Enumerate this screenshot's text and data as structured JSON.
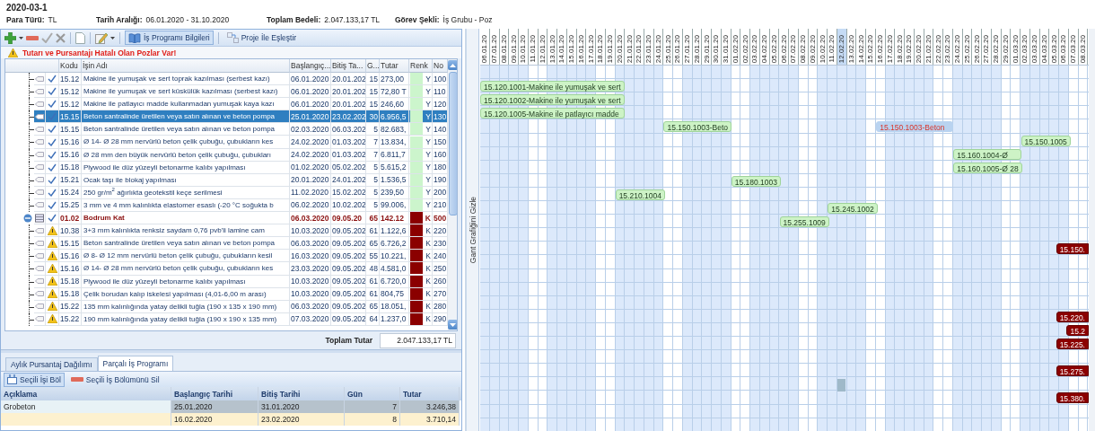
{
  "title": "2020-03-1",
  "info": [
    {
      "label": "Para Türü:",
      "value": "TL"
    },
    {
      "label": "Tarih Aralığı:",
      "value": "06.01.2020 - 31.10.2020"
    },
    {
      "label": "Toplam Bedeli:",
      "value": "2.047.133,17 TL"
    },
    {
      "label": "Görev Şekli:",
      "value": "İş Grubu - Poz"
    }
  ],
  "toolbar": {
    "info_button": {
      "label": "İş Programı Bilgileri",
      "selected": true
    },
    "match_button": {
      "label": "Proje İle Eşleştir"
    }
  },
  "warning": "Tutarı ve Pursantajı Hatalı Olan Pozlar Var!",
  "table": {
    "columns": [
      "Kodu",
      "İşin Adı",
      "Başlangıç...",
      "Bitiş Ta...",
      "G...",
      "Tutar",
      "Renk",
      "No"
    ],
    "rows": [
      {
        "kind": "task",
        "has_error": false,
        "selected": false,
        "code": "15.12",
        "name": "Makine ile yumuşak ve sert toprak kazılması (serbest kazı)",
        "start": "06.01.2020",
        "end": "20.01.202",
        "days": "15",
        "amount": "273,00",
        "color": "#ccf5cc",
        "color_code": "Y",
        "no": "100"
      },
      {
        "kind": "task",
        "has_error": false,
        "selected": false,
        "code": "15.12",
        "name": "Makine ile yumuşak ve sert küskülük kazılması (serbest kazı)",
        "start": "06.01.2020",
        "end": "20.01.202",
        "days": "15",
        "amount": "72,80 T",
        "color": "#ccf5cc",
        "color_code": "Y",
        "no": "110"
      },
      {
        "kind": "task",
        "has_error": false,
        "selected": false,
        "code": "15.12",
        "name": "Makine ile patlayıcı madde kullanmadan yumuşak kaya kazı",
        "start": "06.01.2020",
        "end": "20.01.202",
        "days": "15",
        "amount": "246,60",
        "color": "#ccf5cc",
        "color_code": "Y",
        "no": "120"
      },
      {
        "kind": "task",
        "has_error": false,
        "selected": true,
        "code": "15.15",
        "name": "Beton santralinde üretilen veya satın alınan ve beton pompa",
        "start": "25.01.2020",
        "end": "23.02.202",
        "days": "30",
        "amount": "6.956,5",
        "color": "#ccf5cc",
        "color_code": "Y",
        "no": "130"
      },
      {
        "kind": "task",
        "has_error": false,
        "selected": false,
        "code": "15.15",
        "name": "Beton santralinde üretilen veya satın alınan ve beton pompa",
        "start": "02.03.2020",
        "end": "06.03.202",
        "days": "5",
        "amount": "82.683,",
        "color": "#ccf5cc",
        "color_code": "Y",
        "no": "140"
      },
      {
        "kind": "task",
        "has_error": false,
        "selected": false,
        "code": "15.16",
        "name": "Ø 14- Ø 28 mm nervürlü beton çelik çubuğu, çubukların kes",
        "start": "24.02.2020",
        "end": "01.03.202",
        "days": "7",
        "amount": "13.834,",
        "color": "#ccf5cc",
        "color_code": "Y",
        "no": "150"
      },
      {
        "kind": "task",
        "has_error": false,
        "selected": false,
        "code": "15.16",
        "name": "Ø 28 mm den büyük nervürlü beton çelik çubuğu, çubukları",
        "start": "24.02.2020",
        "end": "01.03.202",
        "days": "7",
        "amount": "6.811,7",
        "color": "#ccf5cc",
        "color_code": "Y",
        "no": "160"
      },
      {
        "kind": "task",
        "has_error": false,
        "selected": false,
        "code": "15.18",
        "name": "Plywood ile düz yüzeyli betonarme kalıbı yapılması",
        "start": "01.02.2020",
        "end": "05.02.202",
        "days": "5",
        "amount": "5.615,2",
        "color": "#ccf5cc",
        "color_code": "Y",
        "no": "180"
      },
      {
        "kind": "task",
        "has_error": false,
        "selected": false,
        "code": "15.21",
        "name": "Ocak taşı ile blokaj yapılması",
        "start": "20.01.2020",
        "end": "24.01.202",
        "days": "5",
        "amount": "1.536,5",
        "color": "#ccf5cc",
        "color_code": "Y",
        "no": "190"
      },
      {
        "kind": "task",
        "has_error": false,
        "selected": false,
        "code": "15.24",
        "name": "250 gr/m$^{2}$ ağırlıkta geotekstil keçe serilmesi",
        "start": "11.02.2020",
        "end": "15.02.202",
        "days": "5",
        "amount": "239,50",
        "color": "#ccf5cc",
        "color_code": "Y",
        "no": "200"
      },
      {
        "kind": "task",
        "has_error": false,
        "selected": false,
        "code": "15.25",
        "name": "3 mm ve 4 mm kalınlıkta elastomer esaslı (-20 °C soğukta b",
        "start": "06.02.2020",
        "end": "10.02.202",
        "days": "5",
        "amount": "99.006,",
        "color": "#ccf5cc",
        "color_code": "Y",
        "no": "210"
      },
      {
        "kind": "group",
        "has_error": false,
        "selected": false,
        "expanded": true,
        "code": "01.02",
        "name": "Bodrum Kat",
        "start": "06.03.2020",
        "end": "09.05.20",
        "days": "65",
        "amount": "142.12",
        "color": "#8b0000",
        "color_code": "K",
        "no": "500"
      },
      {
        "kind": "task",
        "has_error": true,
        "selected": false,
        "code": "10.38",
        "name": "3+3 mm kalınlıkta renksiz saydam 0,76 pvb'li lamine cam",
        "start": "10.03.2020",
        "end": "09.05.202",
        "days": "61",
        "amount": "1.122,6",
        "color": "#8b0000",
        "color_code": "K",
        "no": "220"
      },
      {
        "kind": "task",
        "has_error": true,
        "selected": false,
        "code": "15.15",
        "name": "Beton santralinde üretilen veya satın alınan ve beton pompa",
        "start": "06.03.2020",
        "end": "09.05.202",
        "days": "65",
        "amount": "6.726,2",
        "color": "#8b0000",
        "color_code": "K",
        "no": "230"
      },
      {
        "kind": "task",
        "has_error": true,
        "selected": false,
        "code": "15.16",
        "name": "Ø 8- Ø 12 mm nervürlü beton çelik çubuğu, çubukların kesil",
        "start": "16.03.2020",
        "end": "09.05.202",
        "days": "55",
        "amount": "10.221,",
        "color": "#8b0000",
        "color_code": "K",
        "no": "240"
      },
      {
        "kind": "task",
        "has_error": true,
        "selected": false,
        "code": "15.16",
        "name": "Ø 14- Ø 28 mm nervürlü beton çelik çubuğu, çubukların kes",
        "start": "23.03.2020",
        "end": "09.05.202",
        "days": "48",
        "amount": "4.581,0",
        "color": "#8b0000",
        "color_code": "K",
        "no": "250"
      },
      {
        "kind": "task",
        "has_error": true,
        "selected": false,
        "code": "15.18",
        "name": "Plywood ile düz yüzeyli betonarme kalıbı yapılması",
        "start": "10.03.2020",
        "end": "09.05.202",
        "days": "61",
        "amount": "6.720,0",
        "color": "#8b0000",
        "color_code": "K",
        "no": "260"
      },
      {
        "kind": "task",
        "has_error": true,
        "selected": false,
        "code": "15.18",
        "name": "Çelik borudan kalıp iskelesi yapılması (4,01-6,00 m arası)",
        "start": "10.03.2020",
        "end": "09.05.202",
        "days": "61",
        "amount": "804,75",
        "color": "#8b0000",
        "color_code": "K",
        "no": "270"
      },
      {
        "kind": "task",
        "has_error": true,
        "selected": false,
        "code": "15.22",
        "name": "135 mm kalınlığında yatay delikli tuğla (190 x 135 x 190 mm)",
        "start": "06.03.2020",
        "end": "09.05.202",
        "days": "65",
        "amount": "18.051,",
        "color": "#8b0000",
        "color_code": "K",
        "no": "280"
      },
      {
        "kind": "task",
        "has_error": true,
        "selected": false,
        "code": "15.22",
        "name": "190 mm kalınlığında yatay delikli tuğla (190 x 190 x 135 mm)",
        "start": "07.03.2020",
        "end": "09.05.202",
        "days": "64",
        "amount": "1.237,0",
        "color": "#8b0000",
        "color_code": "K",
        "no": "290"
      }
    ]
  },
  "total": {
    "label": "Toplam Tutar",
    "value": "2.047.133,17 TL"
  },
  "bottom": {
    "tabs": [
      {
        "label": "Aylık Pursantaj Dağılımı",
        "selected": false
      },
      {
        "label": "Parçalı İş Programı",
        "selected": true
      }
    ],
    "actions": [
      {
        "label": "Seçili İşi Böl",
        "selected": true
      },
      {
        "label": "Seçili İş Bölümünü Sil",
        "selected": false
      }
    ],
    "columns": [
      "Açıklama",
      "Başlangıç Tarihi",
      "Bitiş Tarihi",
      "Gün",
      "Tutar"
    ],
    "rows": [
      {
        "description": "Grobeton",
        "start": "25.01.2020",
        "end": "31.01.2020",
        "days": "7",
        "amount": "3.246,38",
        "selected": true
      },
      {
        "start": "16.02.2020",
        "end": "23.02.2020",
        "days": "8",
        "amount": "3.710,14",
        "selected": false
      }
    ]
  },
  "gantt": {
    "toggle_label": "Gant Grafiğini Gizle",
    "days": [
      {
        "label": "06.01.20",
        "weekend": false,
        "selected": false
      },
      {
        "label": "07.01.20",
        "weekend": false,
        "selected": false
      },
      {
        "label": "08.01.20",
        "weekend": false,
        "selected": false
      },
      {
        "label": "09.01.20",
        "weekend": false,
        "selected": false
      },
      {
        "label": "10.01.20",
        "weekend": false,
        "selected": false
      },
      {
        "label": "11.01.20",
        "weekend": true,
        "selected": false
      },
      {
        "label": "12.01.20",
        "weekend": true,
        "selected": false
      },
      {
        "label": "13.01.20",
        "weekend": false,
        "selected": false
      },
      {
        "label": "14.01.20",
        "weekend": false,
        "selected": false
      },
      {
        "label": "15.01.20",
        "weekend": false,
        "selected": false
      },
      {
        "label": "16.01.20",
        "weekend": false,
        "selected": false
      },
      {
        "label": "17.01.20",
        "weekend": false,
        "selected": false
      },
      {
        "label": "18.01.20",
        "weekend": true,
        "selected": false
      },
      {
        "label": "19.01.20",
        "weekend": true,
        "selected": false
      },
      {
        "label": "20.01.20",
        "weekend": false,
        "selected": false
      },
      {
        "label": "21.01.20",
        "weekend": false,
        "selected": false
      },
      {
        "label": "22.01.20",
        "weekend": false,
        "selected": false
      },
      {
        "label": "23.01.20",
        "weekend": false,
        "selected": false
      },
      {
        "label": "24.01.20",
        "weekend": false,
        "selected": false
      },
      {
        "label": "25.01.20",
        "weekend": true,
        "selected": false
      },
      {
        "label": "26.01.20",
        "weekend": true,
        "selected": false
      },
      {
        "label": "27.01.20",
        "weekend": false,
        "selected": false
      },
      {
        "label": "28.01.20",
        "weekend": false,
        "selected": false
      },
      {
        "label": "29.01.20",
        "weekend": false,
        "selected": false
      },
      {
        "label": "30.01.20",
        "weekend": false,
        "selected": false
      },
      {
        "label": "31.01.20",
        "weekend": false,
        "selected": false
      },
      {
        "label": "01.02.20",
        "weekend": true,
        "selected": false
      },
      {
        "label": "02.02.20",
        "weekend": true,
        "selected": false
      },
      {
        "label": "03.02.20",
        "weekend": false,
        "selected": false
      },
      {
        "label": "04.02.20",
        "weekend": false,
        "selected": false
      },
      {
        "label": "05.02.20",
        "weekend": false,
        "selected": false
      },
      {
        "label": "06.02.20",
        "weekend": false,
        "selected": false
      },
      {
        "label": "07.02.20",
        "weekend": false,
        "selected": false
      },
      {
        "label": "08.02.20",
        "weekend": true,
        "selected": false
      },
      {
        "label": "09.02.20",
        "weekend": true,
        "selected": false
      },
      {
        "label": "10.02.20",
        "weekend": false,
        "selected": false
      },
      {
        "label": "11.02.20",
        "weekend": false,
        "selected": false
      },
      {
        "label": "12.02.20",
        "weekend": false,
        "selected": true
      },
      {
        "label": "13.02.20",
        "weekend": false,
        "selected": false
      },
      {
        "label": "14.02.20",
        "weekend": false,
        "selected": false
      },
      {
        "label": "15.02.20",
        "weekend": true,
        "selected": false
      },
      {
        "label": "16.02.20",
        "weekend": true,
        "selected": false
      },
      {
        "label": "17.02.20",
        "weekend": false,
        "selected": false
      },
      {
        "label": "18.02.20",
        "weekend": false,
        "selected": false
      },
      {
        "label": "19.02.20",
        "weekend": false,
        "selected": false
      },
      {
        "label": "20.02.20",
        "weekend": false,
        "selected": false
      },
      {
        "label": "21.02.20",
        "weekend": false,
        "selected": false
      },
      {
        "label": "22.02.20",
        "weekend": true,
        "selected": false
      },
      {
        "label": "23.02.20",
        "weekend": true,
        "selected": false
      },
      {
        "label": "24.02.20",
        "weekend": false,
        "selected": false
      },
      {
        "label": "25.02.20",
        "weekend": false,
        "selected": false
      },
      {
        "label": "26.02.20",
        "weekend": false,
        "selected": false
      },
      {
        "label": "27.02.20",
        "weekend": false,
        "selected": false
      },
      {
        "label": "28.02.20",
        "weekend": false,
        "selected": false
      },
      {
        "label": "29.02.20",
        "weekend": true,
        "selected": false
      },
      {
        "label": "01.03.20",
        "weekend": true,
        "selected": false
      },
      {
        "label": "02.03.20",
        "weekend": false,
        "selected": false
      },
      {
        "label": "03.03.20",
        "weekend": false,
        "selected": false
      },
      {
        "label": "04.03.20",
        "weekend": false,
        "selected": false
      },
      {
        "label": "05.03.20",
        "weekend": false,
        "selected": false
      },
      {
        "label": "06.03.20",
        "weekend": false,
        "selected": false
      },
      {
        "label": "07.03.20",
        "weekend": true,
        "selected": false
      },
      {
        "label": "08.03.20",
        "weekend": true,
        "selected": false
      }
    ],
    "rows": [
      {
        "kind": "task",
        "bars": [
          {
            "label": "15.120.1001-Makine ile yumuşak ve sert",
            "kind": "normal"
          }
        ]
      },
      {
        "kind": "task",
        "bars": [
          {
            "label": "15.120.1002-Makine ile yumuşak ve sert",
            "kind": "normal"
          }
        ]
      },
      {
        "kind": "task",
        "bars": [
          {
            "label": "15.120.1005-Makine ile patlayıcı madde",
            "kind": "normal"
          }
        ]
      },
      {
        "kind": "task",
        "bars": [
          {
            "label": "15.150.1003-Beto",
            "kind": "part"
          },
          {
            "label": "15.150.1003-Beton",
            "kind": "part_selected"
          }
        ]
      },
      {
        "kind": "task",
        "bars": [
          {
            "label": "15.150.1005",
            "kind": "normal"
          }
        ]
      },
      {
        "kind": "task",
        "bars": [
          {
            "label": "15.160.1004-Ø",
            "kind": "normal"
          }
        ]
      },
      {
        "kind": "task",
        "bars": [
          {
            "label": "15.160.1005-Ø 28",
            "kind": "normal"
          }
        ]
      },
      {
        "kind": "task",
        "bars": [
          {
            "label": "15.180.1003",
            "kind": "normal"
          }
        ]
      },
      {
        "kind": "task",
        "bars": [
          {
            "label": "15.210.1004",
            "kind": "normal"
          }
        ]
      },
      {
        "kind": "task",
        "bars": [
          {
            "label": "15.245.1002",
            "kind": "normal"
          }
        ]
      },
      {
        "kind": "task",
        "bars": [
          {
            "label": "15.255.1009",
            "kind": "normal"
          }
        ]
      },
      {
        "kind": "empty"
      },
      {
        "kind": "task",
        "bars": [
          {
            "label": "15.150.",
            "kind": "overdue"
          }
        ]
      },
      {
        "kind": "empty"
      },
      {
        "kind": "empty"
      },
      {
        "kind": "empty"
      },
      {
        "kind": "empty"
      },
      {
        "kind": "task",
        "bars": [
          {
            "label": "15.220.",
            "kind": "overdue"
          }
        ]
      },
      {
        "kind": "task",
        "bars": [
          {
            "label": "15.2",
            "kind": "overdue"
          }
        ]
      },
      {
        "kind": "task",
        "bars": [
          {
            "label": "15.225.",
            "kind": "overdue"
          }
        ]
      },
      {
        "kind": "empty"
      },
      {
        "kind": "task",
        "bars": [
          {
            "label": "15.275.",
            "kind": "overdue"
          }
        ]
      },
      {
        "kind": "task",
        "bars": [
          {
            "kind": "marker"
          }
        ]
      },
      {
        "kind": "task",
        "bars": [
          {
            "label": "15.380.",
            "kind": "overdue"
          }
        ]
      }
    ]
  }
}
